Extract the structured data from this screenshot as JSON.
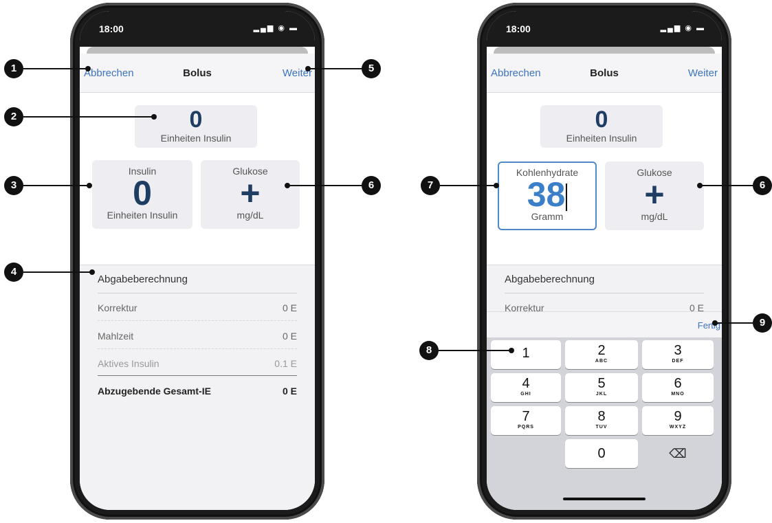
{
  "phone_left": {
    "status": {
      "time": "18:00"
    },
    "nav": {
      "cancel": "Abbrechen",
      "title": "Bolus",
      "next": "Weiter"
    },
    "total": {
      "value": "0",
      "unit": "Einheiten Insulin"
    },
    "insulin_box": {
      "label": "Insulin",
      "value": "0",
      "unit": "Einheiten Insulin"
    },
    "glucose_box": {
      "label": "Glukose",
      "symbol": "+",
      "unit": "mg/dL"
    },
    "calculation": {
      "title": "Abgabeberechnung",
      "rows": [
        {
          "label": "Korrektur",
          "value": "0 E"
        },
        {
          "label": "Mahlzeit",
          "value": "0 E"
        },
        {
          "label": "Aktives Insulin",
          "value": "0.1 E"
        }
      ],
      "total": {
        "label": "Abzugebende Gesamt-IE",
        "value": "0 E"
      }
    }
  },
  "phone_right": {
    "status": {
      "time": "18:00"
    },
    "nav": {
      "cancel": "Abbrechen",
      "title": "Bolus",
      "next": "Weiter"
    },
    "total": {
      "value": "0",
      "unit": "Einheiten Insulin"
    },
    "carbs_box": {
      "label": "Kohlenhydrate",
      "value": "38",
      "unit": "Gramm"
    },
    "glucose_box": {
      "label": "Glukose",
      "symbol": "+",
      "unit": "mg/dL"
    },
    "calculation": {
      "title": "Abgabeberechnung",
      "rows": [
        {
          "label": "Korrektur",
          "value": "0 E"
        }
      ]
    },
    "keyboard": {
      "done": "Fertig",
      "keys": [
        {
          "num": "1",
          "letters": ""
        },
        {
          "num": "2",
          "letters": "ABC"
        },
        {
          "num": "3",
          "letters": "DEF"
        },
        {
          "num": "4",
          "letters": "GHI"
        },
        {
          "num": "5",
          "letters": "JKL"
        },
        {
          "num": "6",
          "letters": "MNO"
        },
        {
          "num": "7",
          "letters": "PQRS"
        },
        {
          "num": "8",
          "letters": "TUV"
        },
        {
          "num": "9",
          "letters": "WXYZ"
        },
        {
          "num": "0",
          "letters": ""
        }
      ],
      "backspace_icon": "backspace-icon"
    }
  },
  "callouts": [
    "1",
    "2",
    "3",
    "4",
    "5",
    "6",
    "7",
    "8",
    "9"
  ],
  "colors": {
    "accent": "#3a73c4",
    "value_dark": "#1f3c63",
    "value_blue": "#3a7fc7",
    "callout": "#111111"
  }
}
